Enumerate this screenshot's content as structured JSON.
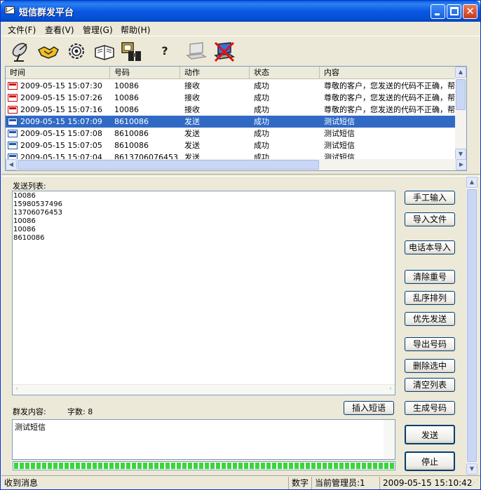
{
  "window": {
    "title": "短信群发平台"
  },
  "menu": [
    "文件(F)",
    "查看(V)",
    "管理(G)",
    "帮助(H)"
  ],
  "toolbar": [
    {
      "icon": "satellite-dish-icon"
    },
    {
      "icon": "handshake-icon"
    },
    {
      "icon": "gear-icon"
    },
    {
      "icon": "book-icon"
    },
    {
      "icon": "contacts-icon"
    },
    {
      "icon": "help-icon",
      "glyph": "?"
    },
    {
      "icon": "laptop-icon"
    },
    {
      "icon": "laptop-disconnect-icon"
    }
  ],
  "log_table": {
    "columns": [
      "时间",
      "号码",
      "动作",
      "状态",
      "内容"
    ],
    "rows": [
      {
        "type": "recv",
        "time": "2009-05-15 15:07:30",
        "number": "10086",
        "action": "接收",
        "status": "成功",
        "content": "尊敬的客户，您发送的代码不正确，帮"
      },
      {
        "type": "recv",
        "time": "2009-05-15 15:07:26",
        "number": "10086",
        "action": "接收",
        "status": "成功",
        "content": "尊敬的客户，您发送的代码不正确，帮"
      },
      {
        "type": "recv",
        "time": "2009-05-15 15:07:16",
        "number": "10086",
        "action": "接收",
        "status": "成功",
        "content": "尊敬的客户，您发送的代码不正确，帮"
      },
      {
        "type": "send",
        "time": "2009-05-15 15:07:09",
        "number": "8610086",
        "action": "发送",
        "status": "成功",
        "content": "测试短信",
        "selected": true
      },
      {
        "type": "send",
        "time": "2009-05-15 15:07:08",
        "number": "8610086",
        "action": "发送",
        "status": "成功",
        "content": "测试短信"
      },
      {
        "type": "send",
        "time": "2009-05-15 15:07:05",
        "number": "8610086",
        "action": "发送",
        "status": "成功",
        "content": "测试短信"
      },
      {
        "type": "send",
        "time": "2009-05-15 15:07:04",
        "number": "8613706076453",
        "action": "发送",
        "status": "成功",
        "content": "测试短信"
      }
    ]
  },
  "send_list": {
    "label": "发送列表:",
    "numbers": [
      "10086",
      "15980537496",
      "13706076453",
      "10086",
      "10086",
      "8610086"
    ]
  },
  "buttons": {
    "manual_input": "手工输入",
    "import_file": "导入文件",
    "phonebook_import": "电话本导入",
    "remove_dup": "清除重号",
    "shuffle": "乱序排列",
    "priority_send": "优先发送",
    "export_numbers": "导出号码",
    "delete_selected": "删除选中",
    "clear_list": "清空列表",
    "insert_phrase": "插入短语",
    "generate_numbers": "生成号码",
    "send": "发送",
    "stop": "停止"
  },
  "content": {
    "label": "群发内容:",
    "char_count_label": "字数: 8",
    "text": "测试短信"
  },
  "progress": {
    "fraction": 1.0
  },
  "statusbar": {
    "message": "收到消息",
    "mode": "数字",
    "admin": "当前管理员:1",
    "time": "2009-05-15 15:10:42"
  }
}
